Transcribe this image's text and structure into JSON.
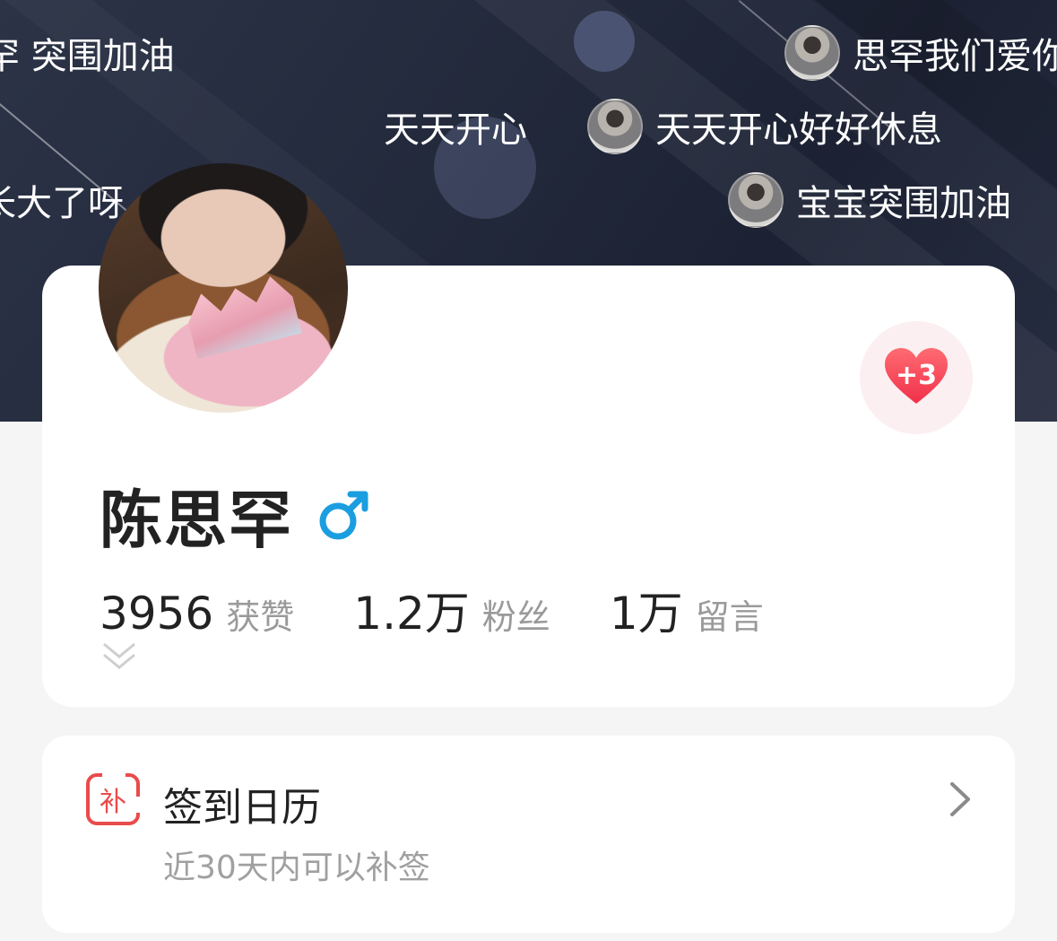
{
  "banner": {
    "danmaku": [
      {
        "text": "罕 突围加油",
        "has_avatar": false
      },
      {
        "text": "思罕我们爱你",
        "has_avatar": true
      },
      {
        "text": "天天开心",
        "has_avatar": false
      },
      {
        "text": "天天开心好好休息",
        "has_avatar": true
      },
      {
        "text": "长大了呀",
        "has_avatar": false
      },
      {
        "text": "宝宝突围加油",
        "has_avatar": true
      }
    ]
  },
  "profile": {
    "name": "陈思罕",
    "gender_icon": "male-icon",
    "like_badge": "+3",
    "stats": [
      {
        "value": "3956",
        "label": "获赞"
      },
      {
        "value": "1.2万",
        "label": "粉丝"
      },
      {
        "value": "1万",
        "label": "留言"
      }
    ]
  },
  "calendar": {
    "icon_char": "补",
    "title": "签到日历",
    "subtitle": "近30天内可以补签"
  },
  "colors": {
    "accent_red": "#e94b4b",
    "male_blue": "#1b9ee0",
    "banner_dark": "#232a3c"
  }
}
